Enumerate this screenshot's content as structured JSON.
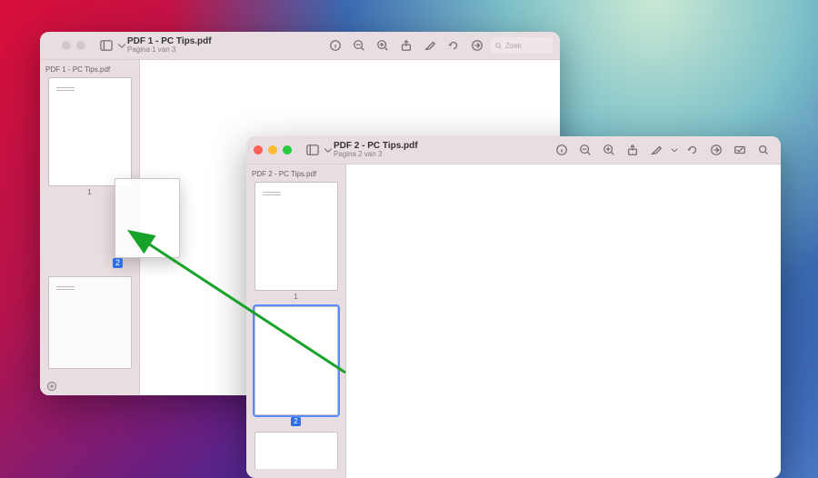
{
  "window1": {
    "title": "PDF 1 - PC Tips.pdf",
    "subtitle": "Pagina 1 van 3",
    "sidebar_title": "PDF 1 - PC Tips.pdf",
    "page1_label": "1",
    "drag_badge": "2",
    "traffic": {
      "close": "#cfc7c9",
      "min": "#cfc7c9",
      "max": "#cfc7c9"
    },
    "search_placeholder": "Zoek"
  },
  "window2": {
    "title": "PDF 2 - PC Tips.pdf",
    "subtitle": "Pagina 2 van 3",
    "sidebar_title": "PDF 2 - PC Tips.pdf",
    "page1_label": "1",
    "page2_badge": "2",
    "traffic": {
      "close": "#ff5f57",
      "min": "#febc2e",
      "max": "#28c840"
    }
  }
}
